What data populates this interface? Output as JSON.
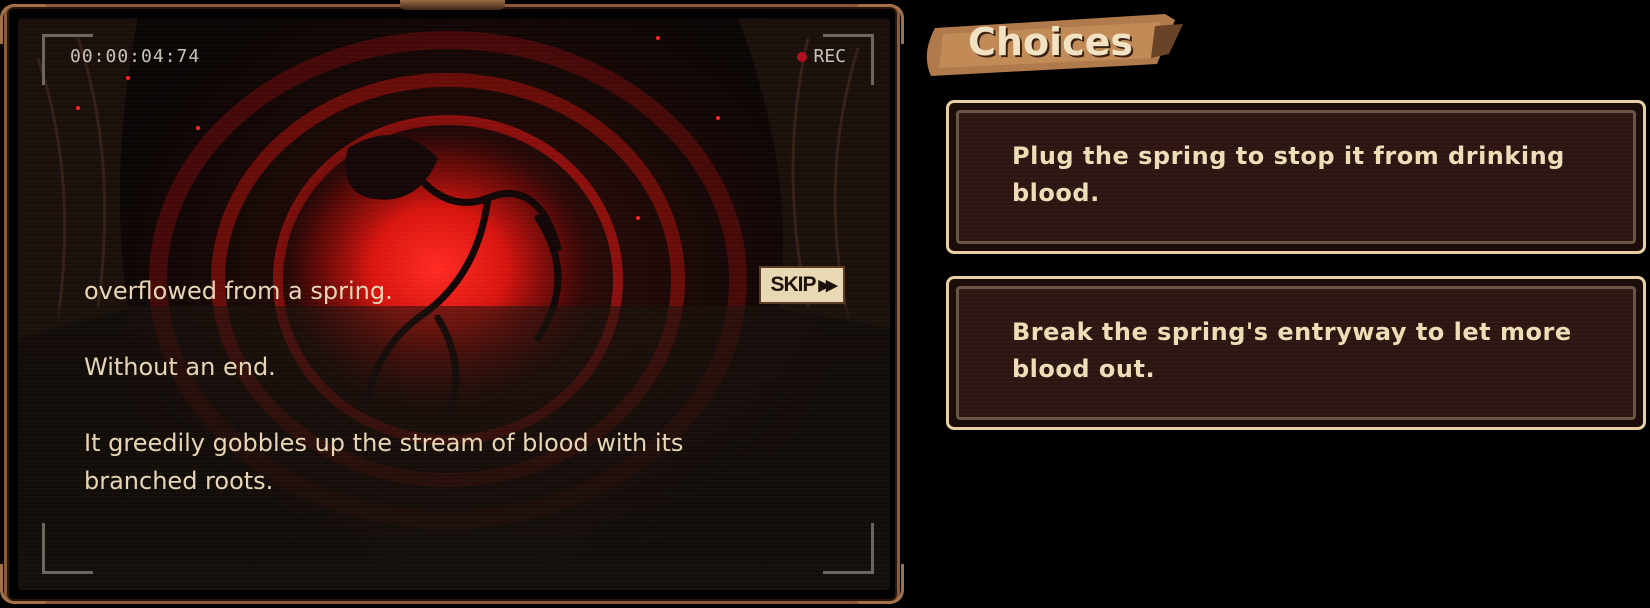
{
  "video": {
    "timecode": "00:00:04:74",
    "rec_label": "REC",
    "skip_label": "SKIP",
    "caption_lines": [
      "overflowed from a spring.",
      "Without an end.",
      "It greedily gobbles up the stream of blood with its branched roots."
    ]
  },
  "choices": {
    "title": "Choices",
    "items": [
      {
        "label": "Plug the spring to stop it from drinking blood."
      },
      {
        "label": "Break the spring's entryway to let more blood out."
      }
    ]
  },
  "colors": {
    "frame": "#8a5a3a",
    "parchment": "#e9d8b4",
    "choice_text": "#f0dcb6",
    "blood_red": "#e01818"
  },
  "icons": {
    "skip": "fast-forward-icon",
    "rec": "record-dot-icon"
  }
}
